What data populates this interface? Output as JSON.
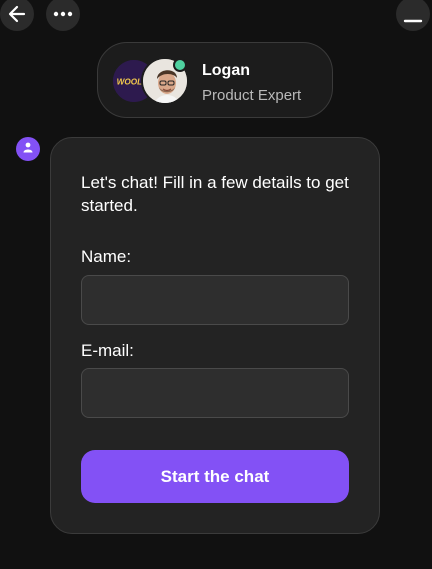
{
  "header": {
    "back_icon": "arrow-left-icon",
    "more_icon": "more-horizontal-icon",
    "minimize_icon": "minimize-icon"
  },
  "agent": {
    "brand_logo_text": "WOOLBET",
    "name": "Logan",
    "role": "Product Expert",
    "status": "online",
    "status_color": "#4fd1a0"
  },
  "form": {
    "intro": "Let's chat! Fill in a few details to get started.",
    "name_label": "Name:",
    "name_value": "",
    "email_label": "E-mail:",
    "email_value": "",
    "submit_label": "Start the chat"
  },
  "colors": {
    "background": "#111111",
    "card": "#232323",
    "accent": "#8351f5",
    "text": "#ffffff",
    "muted_text": "#b9b9b9"
  }
}
